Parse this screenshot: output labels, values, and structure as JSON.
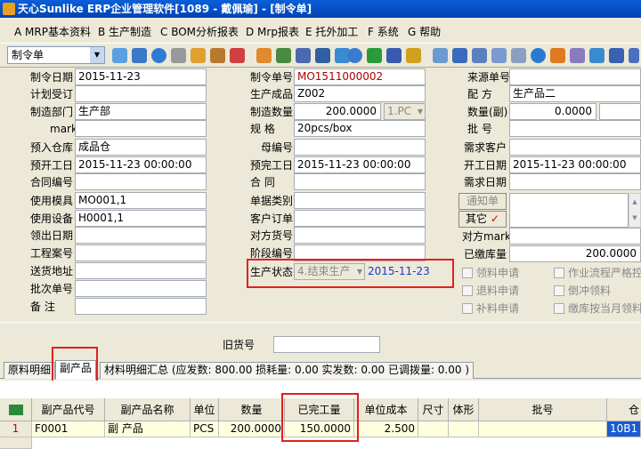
{
  "window": {
    "title": "天心Sunlike ERP企业管理软件[1089 - 戴佩瑜] - [制令单]"
  },
  "menu": [
    "A MRP基本资料",
    "B 生产制造",
    "C BOM分析报表",
    "D Mrp报表",
    "E 托外加工",
    "F 系统",
    "G 帮助"
  ],
  "toolbar": {
    "combo": "制令单"
  },
  "form": {
    "left": [
      {
        "label": "制令日期",
        "value": "2015-11-23"
      },
      {
        "label": "计划受订",
        "value": ""
      },
      {
        "label": "制造部门",
        "value": "生产部"
      },
      {
        "label": "mark",
        "value": ""
      },
      {
        "label": "预入仓库",
        "value": "成品仓"
      },
      {
        "label": "预开工日",
        "value": "2015-11-23 00:00:00"
      },
      {
        "label": "合同编号",
        "value": ""
      },
      {
        "label": "使用模具",
        "value": "MO001,1"
      },
      {
        "label": "使用设备",
        "value": "H0001,1"
      },
      {
        "label": "领出日期",
        "value": ""
      },
      {
        "label": "工程案号",
        "value": ""
      },
      {
        "label": "送货地址",
        "value": ""
      },
      {
        "label": "批次单号",
        "value": ""
      },
      {
        "label": "备    注",
        "value": ""
      }
    ],
    "mid": [
      {
        "label": "制令单号",
        "value": "MO1511000002"
      },
      {
        "label": "生产成品",
        "value": "Z002"
      },
      {
        "label": "制造数量",
        "value": "200.0000",
        "unit": "1.PC"
      },
      {
        "label": "规    格",
        "value": "20pcs/box"
      },
      {
        "label": "母编号",
        "value": ""
      },
      {
        "label": "预完工日",
        "value": "2015-11-23 00:00:00"
      },
      {
        "label": "合    同",
        "value": ""
      },
      {
        "label": "单据类别",
        "value": ""
      },
      {
        "label": "客户订单",
        "value": ""
      },
      {
        "label": "对方货号",
        "value": ""
      },
      {
        "label": "阶段编号",
        "value": ""
      }
    ],
    "status": {
      "label": "生产状态",
      "value": "4.结束生产",
      "date": "2015-11-23"
    },
    "right": [
      {
        "label": "来源单号",
        "value": ""
      },
      {
        "label": "配    方",
        "value": "生产品二"
      },
      {
        "label": "数量(副)",
        "value": "0.0000"
      },
      {
        "label": "批    号",
        "value": ""
      },
      {
        "label": "需求客户",
        "value": ""
      },
      {
        "label": "开工日期",
        "value": "2015-11-23 00:00:00"
      },
      {
        "label": "需求日期",
        "value": ""
      }
    ],
    "notice_button": "通知单",
    "other_button": "其它",
    "other_check": "✓",
    "right2": [
      {
        "label": "对方mark",
        "value": ""
      },
      {
        "label": "已缴库量",
        "value": "200.0000"
      }
    ],
    "checks": [
      "领料申请",
      "退料申请",
      "补料申请",
      "作业流程严格控",
      "倒冲领料",
      "缴库按当月领料"
    ],
    "old_label": "旧货号",
    "old_value": ""
  },
  "tabs": [
    "原料明细",
    "副产品",
    "材料明细汇总 (应发数: 800.00 损耗量: 0.00 实发数: 0.00 已调拨量: 0.00 )"
  ],
  "grid": {
    "columns": [
      "副产品代号",
      "副产品名称",
      "单位",
      "数量",
      "已完工量",
      "单位成本",
      "尺寸",
      "体形",
      "批号",
      "仓"
    ],
    "rows": [
      [
        "1",
        "F0001",
        "副 产品",
        "PCS",
        "200.0000",
        "150.0000",
        "2.500",
        "",
        "",
        "",
        "10B1"
      ]
    ]
  }
}
